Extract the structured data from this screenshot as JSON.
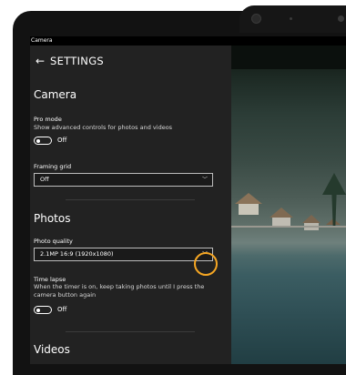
{
  "window": {
    "title": "Camera"
  },
  "header": {
    "back_icon": "back-arrow-icon",
    "title": "SETTINGS"
  },
  "camera_section": {
    "heading": "Camera",
    "pro_mode": {
      "label": "Pro mode",
      "description": "Show advanced controls for photos and videos",
      "state": "Off"
    },
    "framing_grid": {
      "label": "Framing grid",
      "value": "Off",
      "chevron_icon": "chevron-down-icon"
    }
  },
  "photos_section": {
    "heading": "Photos",
    "photo_quality": {
      "label": "Photo quality",
      "value": "2.1MP 16:9 (1920x1080)",
      "chevron_icon": "chevron-down-icon"
    },
    "time_lapse": {
      "label": "Time lapse",
      "description": "When the timer is on, keep taking photos until I press the camera button again",
      "state": "Off"
    }
  },
  "videos_section": {
    "heading": "Videos"
  },
  "colors": {
    "panel_bg": "#222222",
    "highlight": "#f5a623",
    "text": "#ffffff"
  }
}
